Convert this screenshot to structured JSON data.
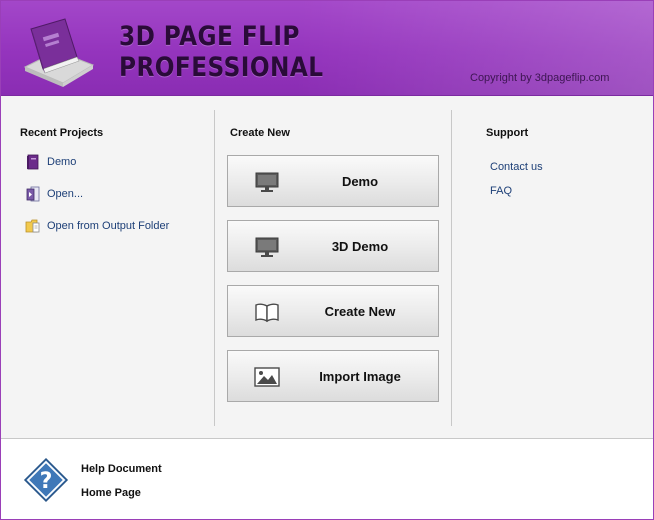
{
  "header": {
    "brand_line1": "3D PAGE FLIP",
    "brand_line2": "PROFESSIONAL",
    "copyright": "Copyright by 3dpageflip.com",
    "accent": "#9434bd"
  },
  "recent": {
    "title": "Recent Projects",
    "items": [
      {
        "label": "Demo",
        "icon": "book-icon"
      },
      {
        "label": "Open...",
        "icon": "open-file-icon"
      },
      {
        "label": "Open from Output Folder",
        "icon": "folder-icon"
      }
    ]
  },
  "create": {
    "title": "Create New",
    "buttons": [
      {
        "label": "Demo",
        "icon": "monitor-icon"
      },
      {
        "label": "3D Demo",
        "icon": "monitor-icon"
      },
      {
        "label": "Create New",
        "icon": "open-book-icon"
      },
      {
        "label": "Import Image",
        "icon": "image-icon"
      }
    ]
  },
  "support": {
    "title": "Support",
    "links": [
      "Contact us",
      "FAQ"
    ]
  },
  "footer": {
    "help_document": "Help Document",
    "home_page": "Home Page"
  }
}
